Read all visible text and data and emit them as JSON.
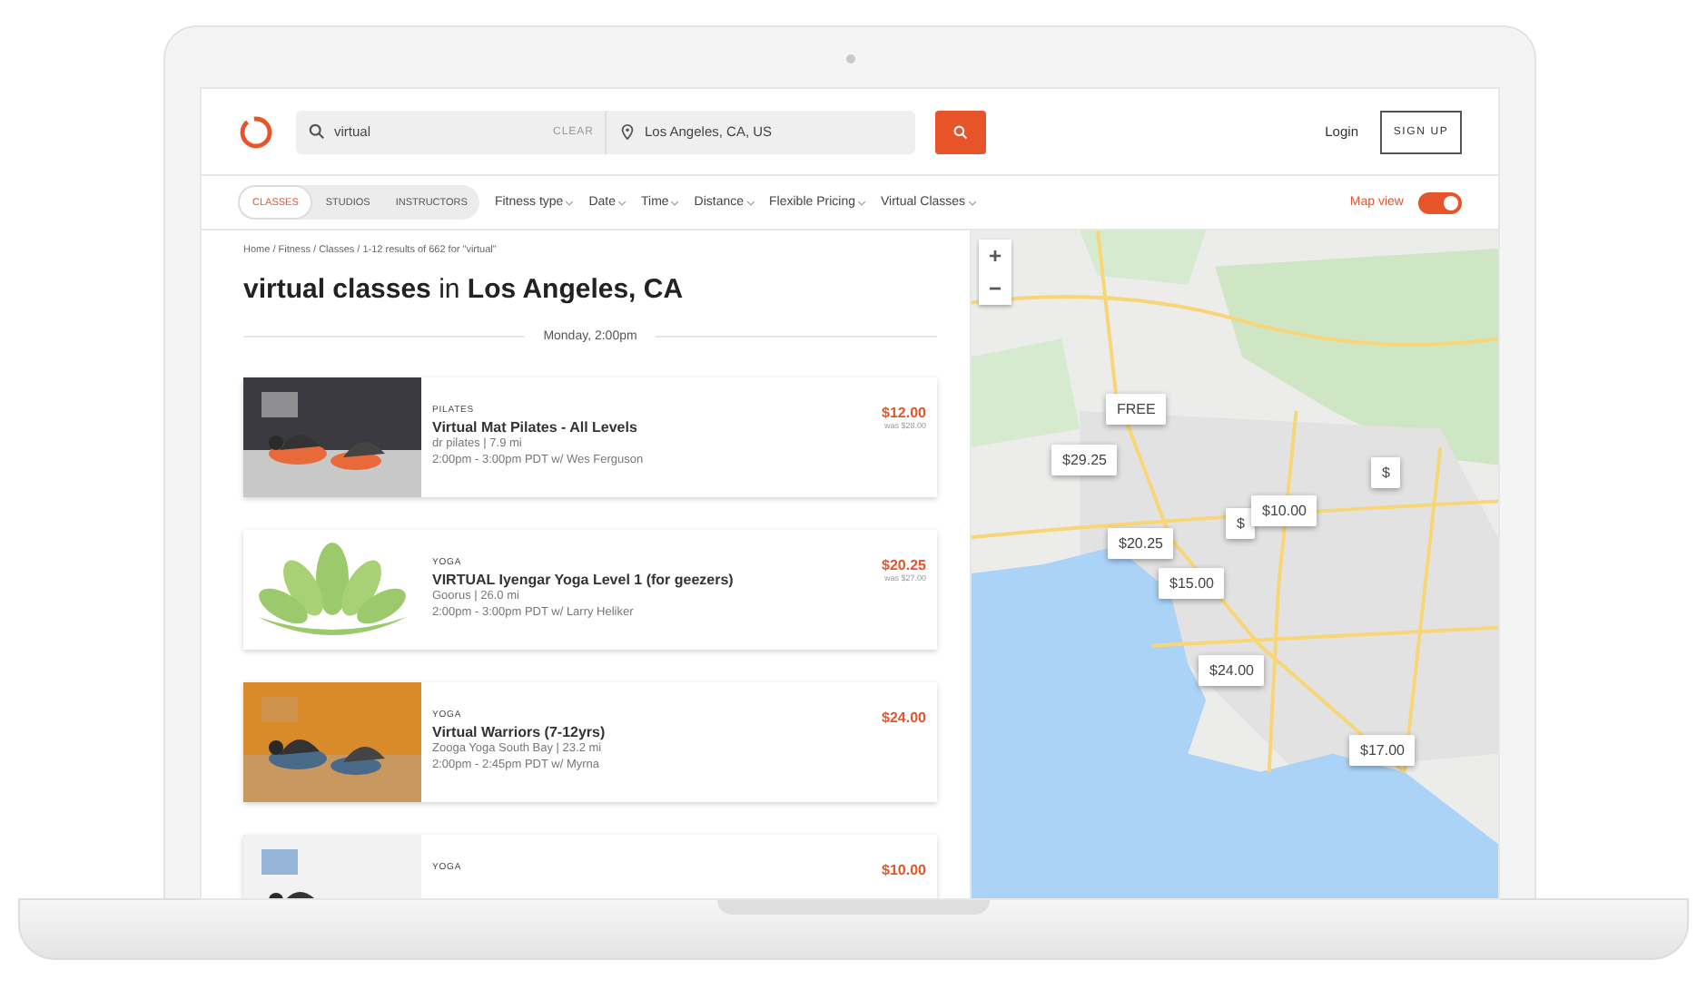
{
  "search": {
    "value": "virtual",
    "clear": "CLEAR",
    "location": "Los Angeles, CA, US"
  },
  "header": {
    "login": "Login",
    "signup": "SIGN UP"
  },
  "filters": {
    "segments": [
      {
        "label": "CLASSES",
        "selected": true
      },
      {
        "label": "STUDIOS",
        "selected": false
      },
      {
        "label": "INSTRUCTORS",
        "selected": false
      }
    ],
    "dropdowns": [
      "Fitness type",
      "Date",
      "Time",
      "Distance",
      "Flexible Pricing",
      "Virtual Classes"
    ],
    "map_view": {
      "label": "Map view",
      "on": true
    }
  },
  "breadcrumb": "Home / Fitness / Classes / 1-12 results of 662 for \"virtual\"",
  "title": "**virtual classes** in **Los Angeles, CA**",
  "date_divider": "Monday, 2:00pm",
  "classes": [
    {
      "category": "PILATES",
      "name": "Virtual Mat Pilates - All Levels",
      "studio": "dr pilates | 7.9 mi",
      "time": "2:00pm - 3:00pm PDT w/ Wes Ferguson",
      "price": "$12.00",
      "was_price": "was $28.00"
    },
    {
      "category": "YOGA",
      "name": "VIRTUAL Iyengar Yoga Level 1 (for geezers)",
      "studio": "Goorus | 26.0 mi",
      "time": "2:00pm - 3:00pm PDT w/ Larry Heliker",
      "price": "$20.25",
      "was_price": "was $27.00",
      "kind": "lotus"
    },
    {
      "category": "YOGA",
      "name": "Virtual Warriors (7-12yrs)",
      "studio": "Zooga Yoga South Bay | 23.2 mi",
      "time": "2:00pm - 2:45pm PDT w/ Myrna",
      "price": "$24.00"
    },
    {
      "category": "YOGA",
      "price": "$10.00"
    }
  ],
  "map": {
    "zoom_in": "+",
    "zoom_out": "−",
    "pins": [
      "FREE",
      "$29.25",
      "$",
      "$",
      "$10.00",
      "$20.25",
      "$15.00",
      "$24.00",
      "$17.00"
    ]
  }
}
